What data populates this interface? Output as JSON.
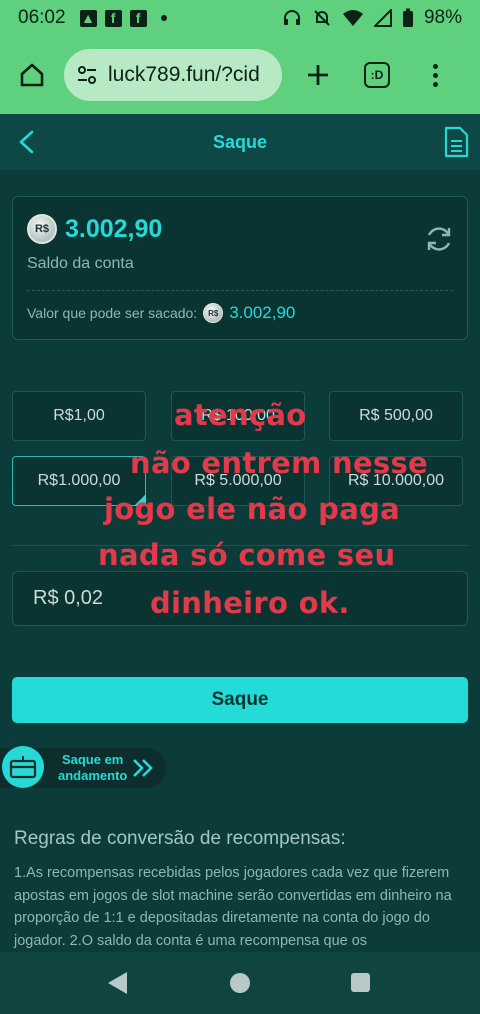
{
  "status_bar": {
    "time": "06:02",
    "battery": "98%"
  },
  "browser": {
    "url": "luck789.fun/?cid",
    "tab_count": ":D"
  },
  "header": {
    "title": "Saque"
  },
  "balance": {
    "amount": "3.002,90",
    "label": "Saldo da conta",
    "currency_badge": "R$",
    "withdrawable_label": "Valor que pode ser sacado:",
    "withdrawable_value": "3.002,90"
  },
  "amount_options": [
    "R$1,00",
    "R$ 100,00",
    "R$ 500,00",
    "R$1.000,00",
    "R$ 5.000,00",
    "R$ 10.000,00"
  ],
  "selected_amount_index": 3,
  "amount_input": {
    "value": "R$ 0,02"
  },
  "saque_button": "Saque",
  "pending": {
    "line1": "Saque em",
    "line2": "andamento"
  },
  "rules": {
    "title": "Regras de conversão de recompensas:",
    "body": "1.As recompensas recebidas pelos jogadores cada vez que fizerem apostas em jogos de slot machine serão convertidas em dinheiro na proporção de 1:1 e depositadas diretamente na conta do jogo do jogador. 2.O saldo da conta é uma recompensa que os"
  },
  "overlay_text": {
    "line1": "atenção",
    "line2": "não entrem nesse",
    "line3": "jogo ele não paga",
    "line4": "nada só come seu",
    "line5": "dinheiro ok."
  },
  "colors": {
    "accent": "#27d9d6",
    "background": "#0c3c3a",
    "browser_bar": "#5ed07e",
    "overlay_text": "#e23a4a"
  }
}
